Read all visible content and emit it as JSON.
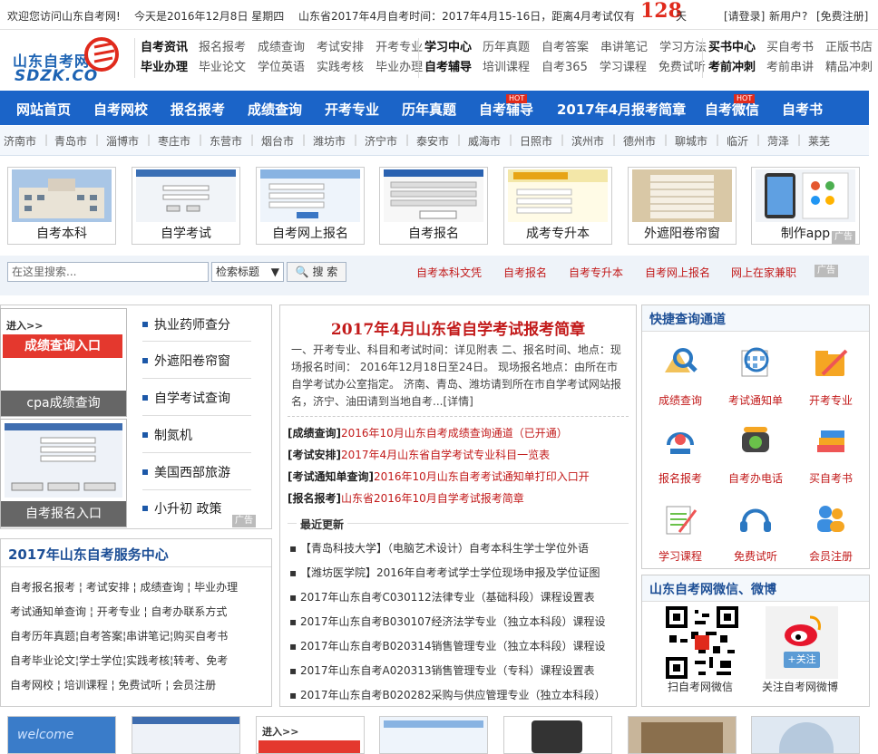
{
  "topbar": {
    "welcome": "欢迎您访问山东自考网!",
    "date": "今天是2016年12月8日 星期四",
    "exam_info": "山东省2017年4月自考时间：2017年4月15-16日，距离4月考试仅有",
    "days": "128",
    "days_unit": "天",
    "login": "[请登录]",
    "new_user": "新用户?",
    "register": "[免费注册]"
  },
  "logo": {
    "cn": "山东自考网",
    "en": "SDZK.CO"
  },
  "header": {
    "g1": {
      "r1": [
        "自考资讯",
        "报名报考",
        "成绩查询",
        "考试安排",
        "开考专业"
      ],
      "r2": [
        "毕业办理",
        "毕业论文",
        "学位英语",
        "实践考核",
        "毕业办理"
      ]
    },
    "g2": {
      "r1": [
        "学习中心",
        "历年真题",
        "自考答案",
        "串讲笔记",
        "学习方法"
      ],
      "r2": [
        "自考辅导",
        "培训课程",
        "自考365",
        "学习课程",
        "免费试听"
      ]
    },
    "g3": {
      "r1": [
        "买书中心",
        "买自考书",
        "正版书店"
      ],
      "r2": [
        "考前冲刺",
        "考前串讲",
        "精品冲刺"
      ]
    }
  },
  "nav": {
    "items": [
      "网站首页",
      "自考网校",
      "报名报考",
      "成绩查询",
      "开考专业",
      "历年真题",
      "自考辅导",
      "2017年4月报考简章",
      "自考微信",
      "自考书"
    ],
    "hot": "HOT"
  },
  "cities": [
    "济南市",
    "青岛市",
    "淄博市",
    "枣庄市",
    "东营市",
    "烟台市",
    "潍坊市",
    "济宁市",
    "泰安市",
    "威海市",
    "日照市",
    "滨州市",
    "德州市",
    "聊城市",
    "临沂",
    "菏泽",
    "莱芜"
  ],
  "thumbs": [
    "自考本科",
    "自学考试",
    "自考网上报名",
    "自考报名",
    "成考专升本",
    "外遮阳卷帘窗",
    "制作app"
  ],
  "ad_label": "广告",
  "search": {
    "placeholder": "在这里搜索...",
    "select": "检索标题",
    "button": "搜 索",
    "links": [
      "自考本科文凭",
      "自考报名",
      "自考专升本",
      "自考网上报名",
      "网上在家兼职"
    ]
  },
  "left": {
    "ad1_caption": "cpa成绩查询",
    "ad1_banner": "成绩查询入口",
    "ad1_enter": "进入>>",
    "ad2_caption": "自考报名入口",
    "ad_list": [
      "执业药师查分",
      "外遮阳卷帘窗",
      "自学考试查询",
      "制氮机",
      "美国西部旅游",
      "小升初 政策"
    ],
    "service_title": "2017年山东自考服务中心",
    "service_rows": [
      [
        "自考报名报考",
        "考试安排",
        "成绩查询",
        "毕业办理"
      ],
      [
        "考试通知单查询",
        "开考专业",
        "自考办联系方式"
      ],
      [
        "自考历年真题",
        "自考答案",
        "串讲笔记",
        "购买自考书"
      ],
      [
        "自考毕业论文",
        "学士学位",
        "实践考核",
        "转考、免考"
      ],
      [
        "自考网校",
        "培训课程",
        "免费试听",
        "会员注册"
      ]
    ]
  },
  "center": {
    "title": "2017年4月山东省自学考试报考简章",
    "desc": "一、开考专业、科目和考试时间：详见附表 二、报名时间、地点：现场报名时间： 2016年12月18日至24日。 现场报名地点：由所在市自学考试办公室指定。 济南、青岛、潍坊请到所在市自学考试网站报名，济宁、油田请到当地自考...[详情]",
    "highlights": [
      {
        "label": "[成绩查询]",
        "text": "2016年10月山东自考成绩查询通道（已开通）"
      },
      {
        "label": "[考试安排]",
        "text": "2017年4月山东省自学考试专业科目一览表"
      },
      {
        "label": "[考试通知单查询]",
        "text": "2016年10月山东自考考试通知单打印入口开"
      },
      {
        "label": "[报名报考]",
        "text": "山东省2016年10月自学考试报考简章"
      }
    ],
    "latest_title": "最近更新",
    "news": [
      "【青岛科技大学】（电脑艺术设计）自考本科生学士学位外语",
      "【潍坊医学院】2016年自考考试学士学位现场申报及学位证图",
      "2017年山东自考C030112法律专业（基础科段）课程设置表",
      "2017年山东自考B030107经济法学专业（独立本科段）课程设",
      "2017年山东自考B020314销售管理专业（独立本科段）课程设",
      "2017年山东自考A020313销售管理专业（专科）课程设置表",
      "2017年山东自考B020282采购与供应管理专业（独立本科段）"
    ]
  },
  "right": {
    "quick_title": "快捷查询通道",
    "quick": [
      "成绩查询",
      "考试通知单",
      "开考专业",
      "报名报考",
      "自考办电话",
      "买自考书",
      "学习课程",
      "免费试听",
      "会员注册"
    ],
    "weixin_title": "山东自考网微信、微博",
    "qr_caption": "扫自考网微信",
    "weibo_caption": "关注自考网微博",
    "follow": "+关注"
  },
  "colors": {
    "nav": "#1b64c8",
    "accent_red": "#c21a1a",
    "title_blue": "#1d4f96"
  }
}
